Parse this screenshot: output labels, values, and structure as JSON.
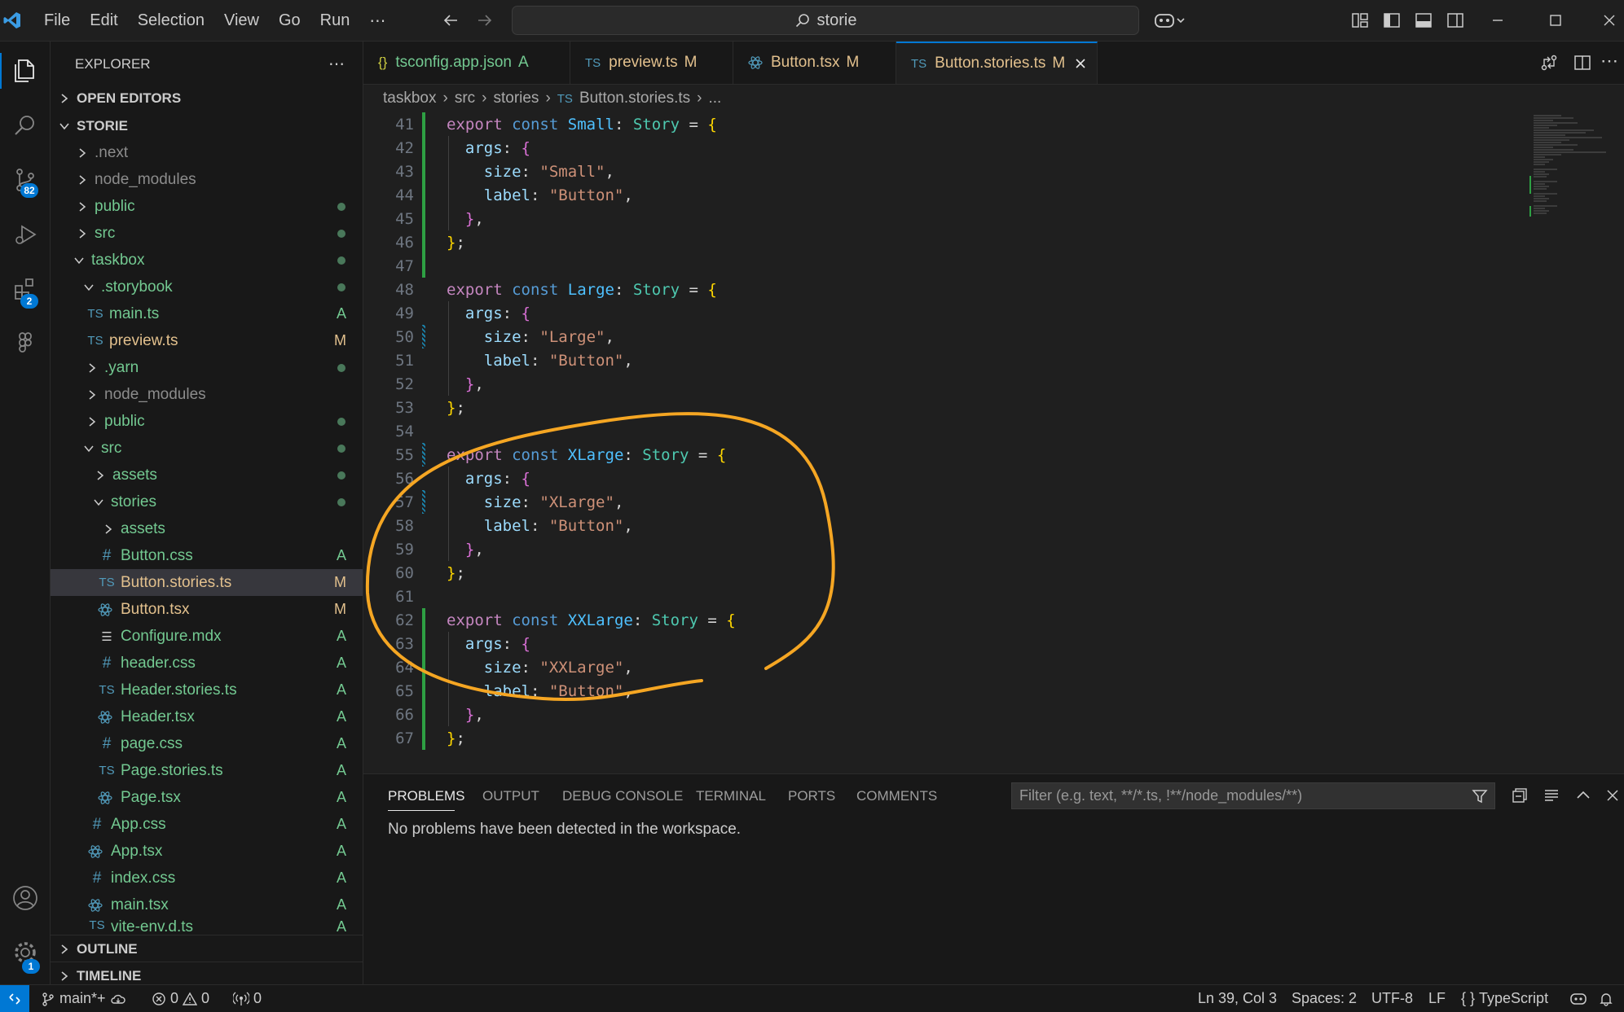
{
  "titlebar": {
    "menu": [
      "File",
      "Edit",
      "Selection",
      "View",
      "Go",
      "Run"
    ],
    "search_text": "storie"
  },
  "activity": {
    "scm_badge": "82",
    "extensions_badge": "2",
    "settings_badge": "1"
  },
  "sidebar": {
    "title": "EXPLORER",
    "open_editors": "OPEN EDITORS",
    "root": "STORIE",
    "tree": [
      {
        "label": "node_modules_top",
        "text": ".next"
      },
      {
        "text": "node_modules"
      },
      {
        "text": "public"
      },
      {
        "text": "src"
      },
      {
        "text": "taskbox"
      },
      {
        "text": ".storybook"
      },
      {
        "text": "main.ts",
        "status": "A"
      },
      {
        "text": "preview.ts",
        "status": "M"
      },
      {
        "text": ".yarn"
      },
      {
        "text": "node_modules"
      },
      {
        "text": "public"
      },
      {
        "text": "src"
      },
      {
        "text": "assets"
      },
      {
        "text": "stories"
      },
      {
        "text": "assets"
      },
      {
        "text": "Button.css",
        "status": "A"
      },
      {
        "text": "Button.stories.ts",
        "status": "M"
      },
      {
        "text": "Button.tsx",
        "status": "M"
      },
      {
        "text": "Configure.mdx",
        "status": "A"
      },
      {
        "text": "header.css",
        "status": "A"
      },
      {
        "text": "Header.stories.ts",
        "status": "A"
      },
      {
        "text": "Header.tsx",
        "status": "A"
      },
      {
        "text": "page.css",
        "status": "A"
      },
      {
        "text": "Page.stories.ts",
        "status": "A"
      },
      {
        "text": "Page.tsx",
        "status": "A"
      },
      {
        "text": "App.css",
        "status": "A"
      },
      {
        "text": "App.tsx",
        "status": "A"
      },
      {
        "text": "index.css",
        "status": "A"
      },
      {
        "text": "main.tsx",
        "status": "A"
      },
      {
        "text": "vite-env.d.ts",
        "status": "A"
      }
    ],
    "outline": "OUTLINE",
    "timeline": "TIMELINE",
    "icon_ts": "TS"
  },
  "tabs": [
    {
      "name": "tsconfig.app.json",
      "status": "A",
      "icon": "{}"
    },
    {
      "name": "preview.ts",
      "status": "M",
      "icon": "TS"
    },
    {
      "name": "Button.tsx",
      "status": "M",
      "icon": ""
    },
    {
      "name": "Button.stories.ts",
      "status": "M",
      "icon": "TS"
    }
  ],
  "breadcrumb": {
    "parts": [
      "taskbox",
      "src",
      "stories",
      "Button.stories.ts",
      "..."
    ],
    "icon": "TS"
  },
  "code": {
    "line_numbers": [
      "41",
      "42",
      "43",
      "44",
      "45",
      "46",
      "47",
      "48",
      "49",
      "50",
      "51",
      "52",
      "53",
      "54",
      "55",
      "56",
      "57",
      "58",
      "59",
      "60",
      "61",
      "62",
      "63",
      "64",
      "65",
      "66",
      "67"
    ],
    "tokens": {
      "export": "export",
      "const": "const",
      "story": "Story",
      "args": "args",
      "size": "size",
      "label": "label",
      "button_str": "\"Button\""
    },
    "stories": [
      {
        "name": "Small",
        "size": "\"Small\""
      },
      {
        "name": "Large",
        "size": "\"Large\""
      },
      {
        "name": "XLarge",
        "size": "\"XLarge\""
      },
      {
        "name": "XXLarge",
        "size": "\"XXLarge\""
      }
    ]
  },
  "panel": {
    "tabs": [
      "PROBLEMS",
      "OUTPUT",
      "DEBUG CONSOLE",
      "TERMINAL",
      "PORTS",
      "COMMENTS"
    ],
    "filter_placeholder": "Filter (e.g. text, **/*.ts, !**/node_modules/**)",
    "message": "No problems have been detected in the workspace."
  },
  "statusbar": {
    "branch": "main*+",
    "errors": "0",
    "warnings": "0",
    "ports": "0",
    "position": "Ln 39, Col 3",
    "spaces": "Spaces: 2",
    "encoding": "UTF-8",
    "eol": "LF",
    "language": "TypeScript",
    "lang_icon": "{ }"
  },
  "colors": {
    "accent": "#0078d4",
    "annotation": "#f5a623",
    "added": "#73c991",
    "modified": "#e2c08d"
  }
}
